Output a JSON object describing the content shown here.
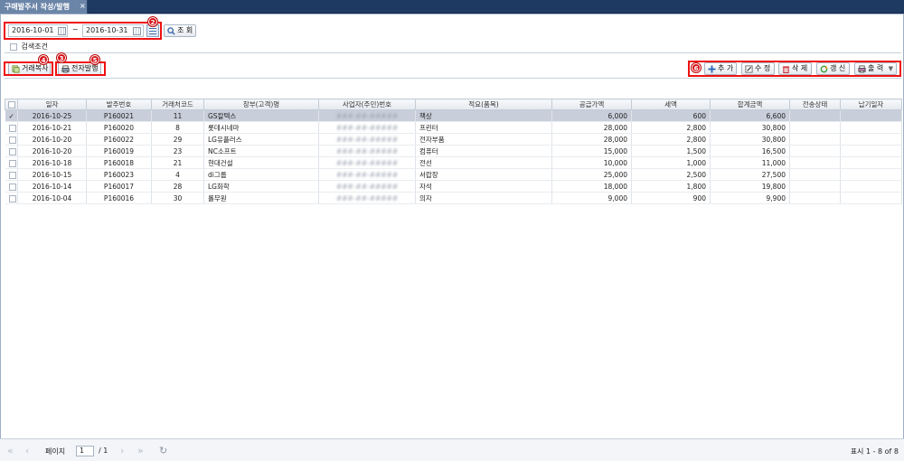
{
  "tab": {
    "title": "구매발주서 작성/발행",
    "close": "×"
  },
  "search": {
    "date_from": "2016-10-01",
    "tilde": "~",
    "date_to": "2016-10-31",
    "search_label": "조 회",
    "condition_label": "검색조건"
  },
  "left_buttons": {
    "copy": "거래복사",
    "issue": "전자발행"
  },
  "right_buttons": {
    "add": "추 가",
    "edit": "수 정",
    "delete": "삭 제",
    "refresh": "갱 신",
    "print": "출 력"
  },
  "badges": [
    "2",
    "3",
    "4",
    "5",
    "6"
  ],
  "table": {
    "headers": [
      "",
      "일자",
      "발주번호",
      "거래처코드",
      "장부(고객)명",
      "사업자(주민)번호",
      "적요(품목)",
      "공급가액",
      "세액",
      "합계금액",
      "전송상태",
      "납기일자"
    ],
    "rows": [
      [
        "✓",
        "2016-10-25",
        "P160021",
        "11",
        "GS칼텍스",
        "###-##-#####",
        "책상",
        "6,000",
        "600",
        "6,600",
        "",
        ""
      ],
      [
        "",
        "2016-10-21",
        "P160020",
        "8",
        "롯데시네마",
        "###-##-#####",
        "프린터",
        "28,000",
        "2,800",
        "30,800",
        "",
        ""
      ],
      [
        "",
        "2016-10-20",
        "P160022",
        "29",
        "LG유플러스",
        "###-##-#####",
        "전자부품",
        "28,000",
        "2,800",
        "30,800",
        "",
        ""
      ],
      [
        "",
        "2016-10-20",
        "P160019",
        "23",
        "NC소프트",
        "###-##-#####",
        "컴퓨터",
        "15,000",
        "1,500",
        "16,500",
        "",
        ""
      ],
      [
        "",
        "2016-10-18",
        "P160018",
        "21",
        "현대건설",
        "###-##-#####",
        "전선",
        "10,000",
        "1,000",
        "11,000",
        "",
        ""
      ],
      [
        "",
        "2016-10-15",
        "P160023",
        "4",
        "di그룹",
        "###-##-#####",
        "서랍장",
        "25,000",
        "2,500",
        "27,500",
        "",
        ""
      ],
      [
        "",
        "2016-10-14",
        "P160017",
        "28",
        "LG화학",
        "###-##-#####",
        "자석",
        "18,000",
        "1,800",
        "19,800",
        "",
        ""
      ],
      [
        "",
        "2016-10-04",
        "P160016",
        "30",
        "롤무원",
        "###-##-#####",
        "의자",
        "9,000",
        "900",
        "9,900",
        "",
        ""
      ]
    ]
  },
  "pager": {
    "page_label": "페이지",
    "page_value": "1",
    "page_total": "/ 1",
    "summary": "표시 1 - 8 of 8"
  },
  "colors": {
    "accent_red": "#e11111",
    "header_navy": "#1f3a62",
    "selected_row": "#c8ceda"
  }
}
